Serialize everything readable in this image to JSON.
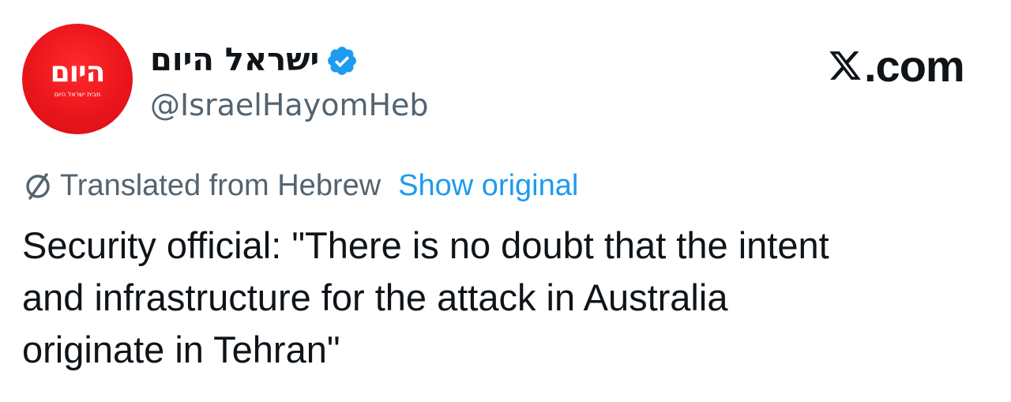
{
  "author": {
    "display_name": "ישראל היום",
    "handle": "@IsraelHayomHeb",
    "avatar": {
      "logo_text": "היום",
      "tagline": "מבית ישראל היום",
      "color": "#e8141b"
    },
    "verified": true
  },
  "brand": {
    "label": ".com",
    "icon": "x-logo-icon"
  },
  "translation": {
    "label": "Translated from Hebrew",
    "action_label": "Show original",
    "icon": "translate-icon",
    "action_color": "#1d9bf0"
  },
  "tweet": {
    "text": "Security official: \"There is no doubt that the intent\nand infrastructure for the attack in Australia\noriginate in Tehran\""
  },
  "colors": {
    "text_primary": "#0f1419",
    "text_secondary": "#536471",
    "verified_badge": "#1d9bf0"
  }
}
